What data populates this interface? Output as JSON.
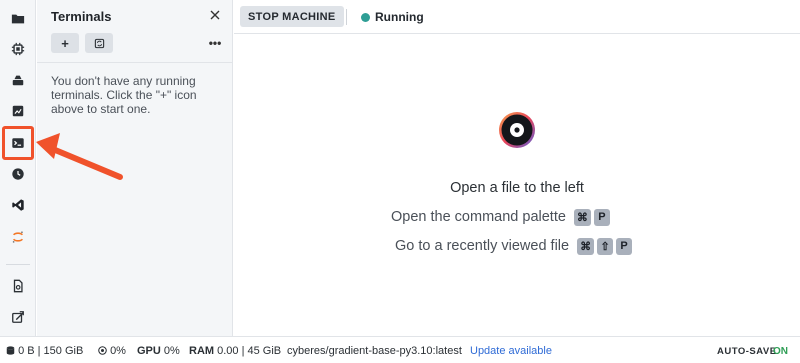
{
  "activity_bar": {
    "items": [
      {
        "icon": "folder-icon"
      },
      {
        "icon": "chip-icon"
      },
      {
        "icon": "machine-icon"
      },
      {
        "icon": "metrics-icon"
      },
      {
        "icon": "terminal-icon"
      },
      {
        "icon": "clock-icon"
      },
      {
        "icon": "vscode-icon"
      },
      {
        "icon": "jupyter-icon"
      },
      {
        "icon": "file-icon"
      },
      {
        "icon": "extensions-icon"
      }
    ],
    "highlight_color": "#f0522b"
  },
  "terminals_panel": {
    "title": "Terminals",
    "new_button": "+",
    "refresh_icon": "refresh-icon",
    "more_label": "•••",
    "empty_message": "You don't have any running terminals. Click the \"+\" icon above to start one."
  },
  "topbar": {
    "stop_label": "STOP MACHINE",
    "status_label": "Running",
    "status_color": "#2e9e95"
  },
  "main": {
    "open_file_text": "Open a file to the left",
    "hints": [
      {
        "text": "Open the command palette",
        "keys": [
          "⌘",
          "P"
        ]
      },
      {
        "text": "Go to a recently viewed file",
        "keys": [
          "⌘",
          "⇧",
          "P"
        ]
      }
    ]
  },
  "statusbar": {
    "storage": "0 B | 150 GiB",
    "cpu": "0%",
    "gpu_label": "GPU",
    "gpu": "0%",
    "ram_label": "RAM",
    "ram": "0.00 | 45 GiB",
    "image": "cyberes/gradient-base-py3.10:latest",
    "update": "Update available",
    "autosave_label": "AUTO-SAVE",
    "autosave_state": "ON"
  }
}
